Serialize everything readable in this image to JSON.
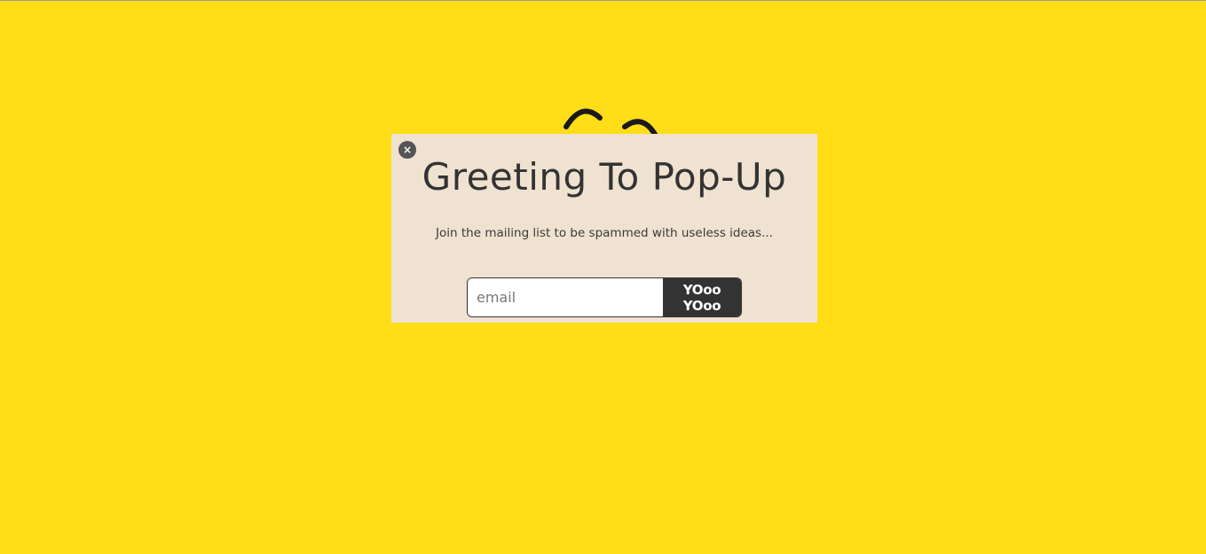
{
  "colors": {
    "background": "#FFDD17",
    "popup_background": "#EFE2D0",
    "dark": "#333333",
    "close_button": "#555555"
  },
  "background_character": {
    "icon": "smiley-eyes-icon"
  },
  "popup": {
    "close_label": "×",
    "close_icon": "close-icon",
    "title": "Greeting To Pop-Up",
    "subtitle": "Join the mailing list to be spammed with useless ideas...",
    "email_input": {
      "value": "",
      "placeholder": "email"
    },
    "submit_label": "YOoo YOoo"
  }
}
